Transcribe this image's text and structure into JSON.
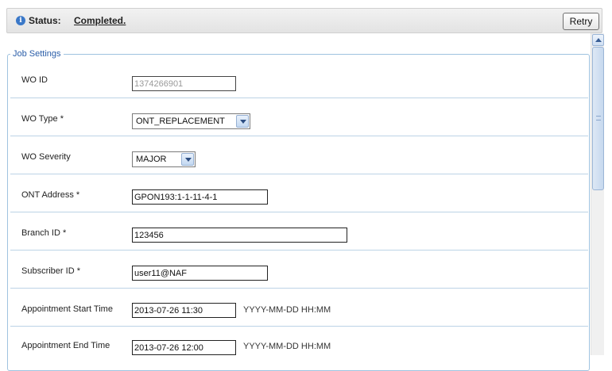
{
  "status": {
    "label": "Status:",
    "value": "Completed.",
    "retry_label": "Retry"
  },
  "settings": {
    "legend": "Job Settings",
    "wo_id": {
      "label": "WO ID",
      "value": "1374266901"
    },
    "wo_type": {
      "label": "WO Type *",
      "value": "ONT_REPLACEMENT"
    },
    "wo_severity": {
      "label": "WO Severity",
      "value": "MAJOR"
    },
    "ont_address": {
      "label": "ONT Address *",
      "value": "GPON193:1-1-11-4-1"
    },
    "branch_id": {
      "label": "Branch ID *",
      "value": "123456"
    },
    "subscriber_id": {
      "label": "Subscriber ID *",
      "value": "user11@NAF"
    },
    "appt_start": {
      "label": "Appointment Start Time",
      "value": "2013-07-26 11:30",
      "hint": "YYYY-MM-DD HH:MM"
    },
    "appt_end": {
      "label": "Appointment End Time",
      "value": "2013-07-26 12:00",
      "hint": "YYYY-MM-DD HH:MM"
    }
  },
  "icons": {
    "status": "info-icon"
  },
  "colors": {
    "legend_text": "#2a5da8",
    "row_divider": "#bcd3e6",
    "fieldset_border": "#9fc3e0"
  }
}
